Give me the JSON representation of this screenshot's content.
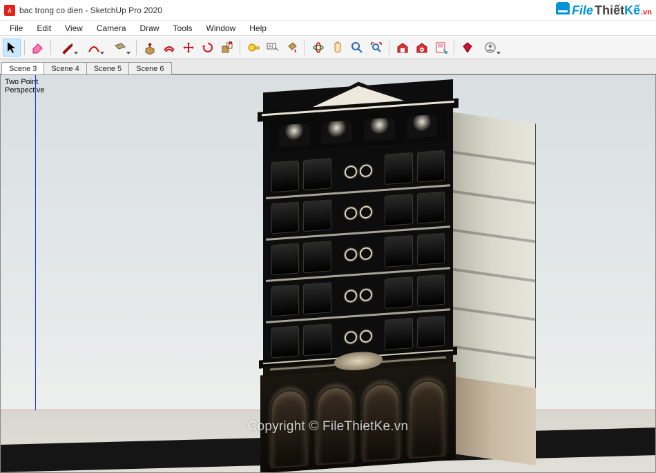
{
  "titlebar": {
    "text": "bac trong co dien - SketchUp Pro 2020"
  },
  "logo": {
    "file": "File",
    "thiet": "Thiết",
    "ke": " Kế",
    "vn": ".vn"
  },
  "menu": {
    "file": "File",
    "edit": "Edit",
    "view": "View",
    "camera": "Camera",
    "draw": "Draw",
    "tools": "Tools",
    "window": "Window",
    "help": "Help"
  },
  "toolbar": {
    "select": "Select",
    "eraser": "Eraser",
    "line": "Line",
    "arc": "Arc",
    "shape": "Rectangle",
    "pushpull": "Push/Pull",
    "offset": "Offset",
    "move": "Move",
    "rotate": "Rotate",
    "scale": "Scale",
    "tape": "Tape Measure",
    "paint": "Paint Bucket",
    "text": "Text",
    "dim": "Dimension",
    "orbit": "Orbit",
    "pan": "Pan",
    "zoom": "Zoom",
    "zoomext": "Zoom Extents",
    "warehouse": "3D Warehouse",
    "extwh": "Extension Warehouse",
    "layout": "Send to LayOut",
    "extmgr": "Extension Manager",
    "user": "Sign In"
  },
  "scenes": {
    "tabs": [
      {
        "label": "Scene 3",
        "active": true
      },
      {
        "label": "Scene 4",
        "active": false
      },
      {
        "label": "Scene 5",
        "active": false
      },
      {
        "label": "Scene 6",
        "active": false
      }
    ]
  },
  "viewport": {
    "camera_label": "Two Point\nPerspective",
    "watermark": "Copyright © FileThietKe.vn"
  }
}
